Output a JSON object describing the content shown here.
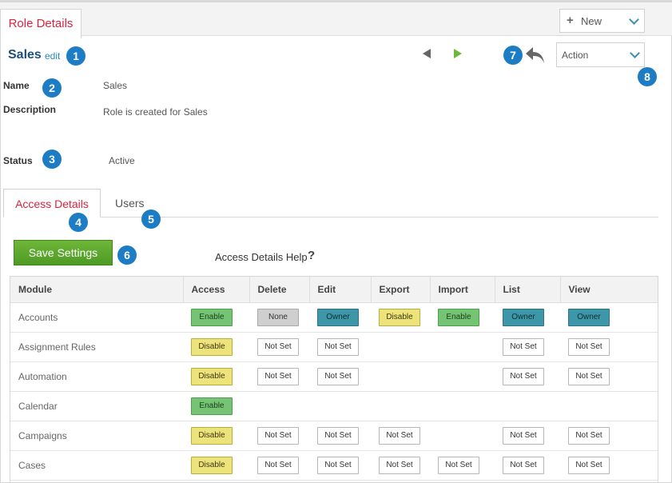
{
  "header": {
    "tab_label": "Role Details",
    "new_button_label": "New",
    "action_label": "Action"
  },
  "record": {
    "title": "Sales",
    "edit_label": "edit",
    "name_label": "Name",
    "name_value": "Sales",
    "description_label": "Description",
    "description_value": "Role is created for Sales",
    "status_label": "Status",
    "status_value": "Active"
  },
  "badges": [
    "1",
    "2",
    "3",
    "4",
    "5",
    "6",
    "7",
    "8"
  ],
  "tabs": {
    "access": "Access Details",
    "users": "Users"
  },
  "toolbar": {
    "save_label": "Save Settings",
    "help_label": "Access Details Help",
    "help_icon": "?"
  },
  "table": {
    "columns": [
      "Module",
      "Access",
      "Delete",
      "Edit",
      "Export",
      "Import",
      "List",
      "View"
    ],
    "rows": [
      {
        "module": "Accounts",
        "cells": [
          "Enable",
          "None",
          "Owner",
          "Disable",
          "Enable",
          "Owner",
          "Owner"
        ]
      },
      {
        "module": "Assignment Rules",
        "cells": [
          "Disable",
          "Not Set",
          "Not Set",
          "",
          "",
          "Not Set",
          "Not Set"
        ]
      },
      {
        "module": "Automation",
        "cells": [
          "Disable",
          "Not Set",
          "Not Set",
          "",
          "",
          "Not Set",
          "Not Set"
        ]
      },
      {
        "module": "Calendar",
        "cells": [
          "Enable",
          "",
          "",
          "",
          "",
          "",
          ""
        ]
      },
      {
        "module": "Campaigns",
        "cells": [
          "Disable",
          "Not Set",
          "Not Set",
          "Not Set",
          "",
          "Not Set",
          "Not Set"
        ]
      },
      {
        "module": "Cases",
        "cells": [
          "Disable",
          "Not Set",
          "Not Set",
          "Not Set",
          "Not Set",
          "Not Set",
          "Not Set"
        ]
      }
    ]
  },
  "colors": {
    "accent_red": "#d9263e",
    "title_blue": "#1d4f7c",
    "badge_blue": "#1c7cc4",
    "save_green": "#5aa82d",
    "enable": "#74c474",
    "disable": "#ece47a",
    "owner": "#3e97a8",
    "none": "#cfcfcf"
  },
  "icons": {
    "new": "plus-icon",
    "prev": "arrow-left-icon",
    "next": "arrow-right-icon",
    "back": "undo-icon",
    "dropdown": "chevron-down-icon",
    "help": "question-icon"
  }
}
